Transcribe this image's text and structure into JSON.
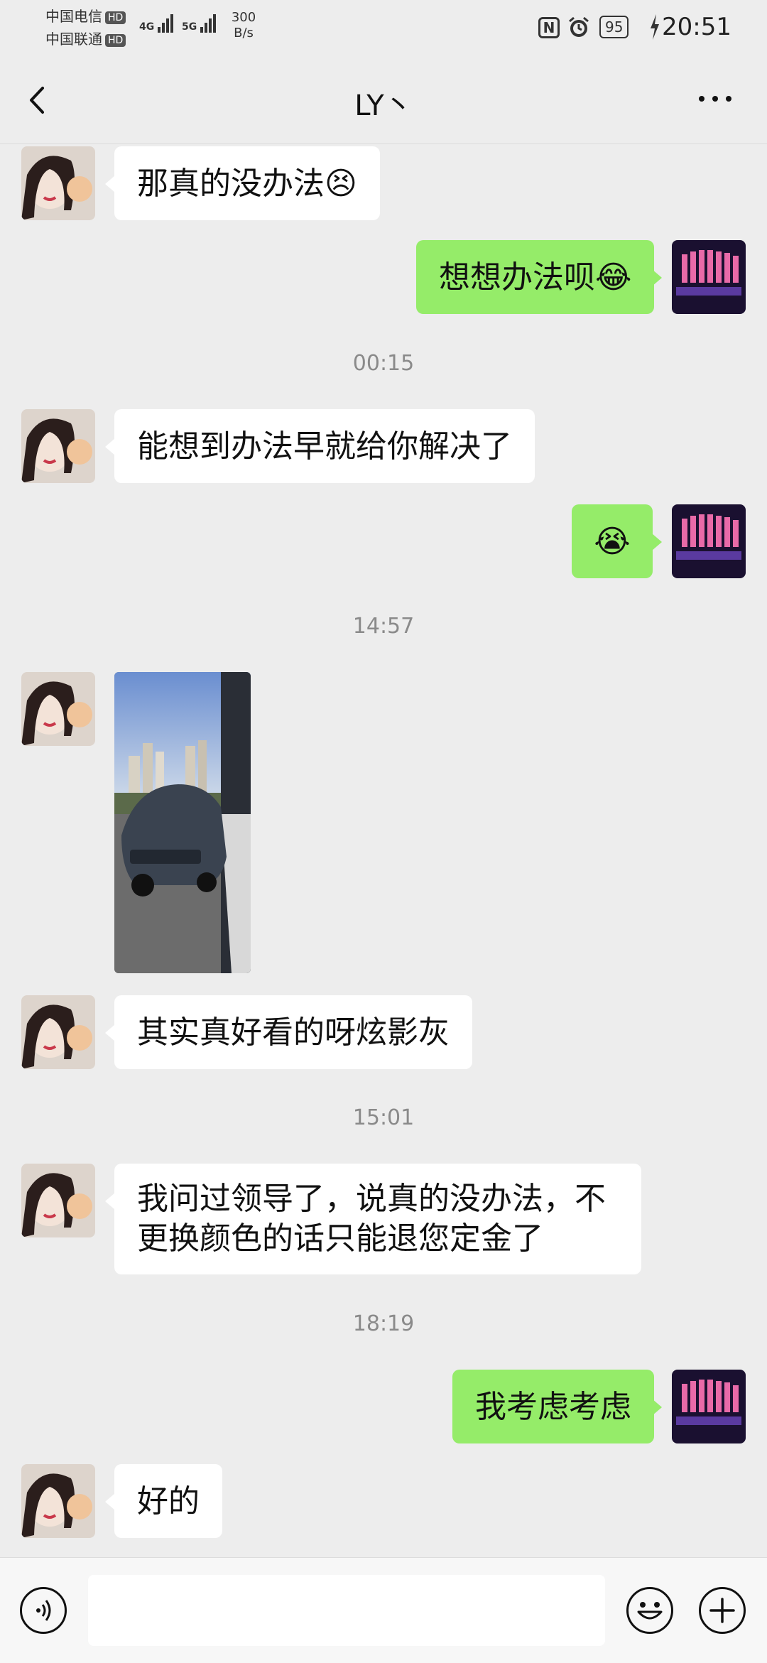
{
  "status_bar": {
    "carrier1": "中国电信",
    "carrier2": "中国联通",
    "hd": "HD",
    "net1": "4G",
    "net2": "5G",
    "speed_value": "300",
    "speed_unit": "B/s",
    "battery": "95",
    "time": "20:51"
  },
  "header": {
    "title": "LY丶",
    "back_icon": "chevron-left-icon",
    "more_icon": "more-horizontal-icon"
  },
  "messages": [
    {
      "side": "in",
      "type": "text",
      "text": "那真的没办法😣"
    },
    {
      "side": "out",
      "type": "text",
      "text": "想想办法呗😂"
    },
    {
      "side": "time",
      "text": "00:15"
    },
    {
      "side": "in",
      "type": "text",
      "text": "能想到办法早就给你解决了"
    },
    {
      "side": "out",
      "type": "text",
      "text": "😭"
    },
    {
      "side": "time",
      "text": "14:57"
    },
    {
      "side": "in",
      "type": "image",
      "content": "car-photo"
    },
    {
      "side": "in",
      "type": "text",
      "text": "其实真好看的呀炫影灰"
    },
    {
      "side": "time",
      "text": "15:01"
    },
    {
      "side": "in",
      "type": "text",
      "line1": "我问过领导了，说真的没办法，不",
      "line2": "更换颜色的话只能退您定金了"
    },
    {
      "side": "time",
      "text": "18:19"
    },
    {
      "side": "out",
      "type": "text",
      "text": "我考虑考虑"
    },
    {
      "side": "in",
      "type": "text",
      "text": "好的"
    }
  ],
  "input_bar": {
    "voice_icon": "voice-icon",
    "emoji_icon": "emoji-icon",
    "plus_icon": "plus-icon",
    "text_value": ""
  },
  "colors": {
    "background": "#ededed",
    "outgoing_bubble": "#95ec69",
    "incoming_bubble": "#ffffff",
    "timestamp": "#8a8a8a"
  }
}
